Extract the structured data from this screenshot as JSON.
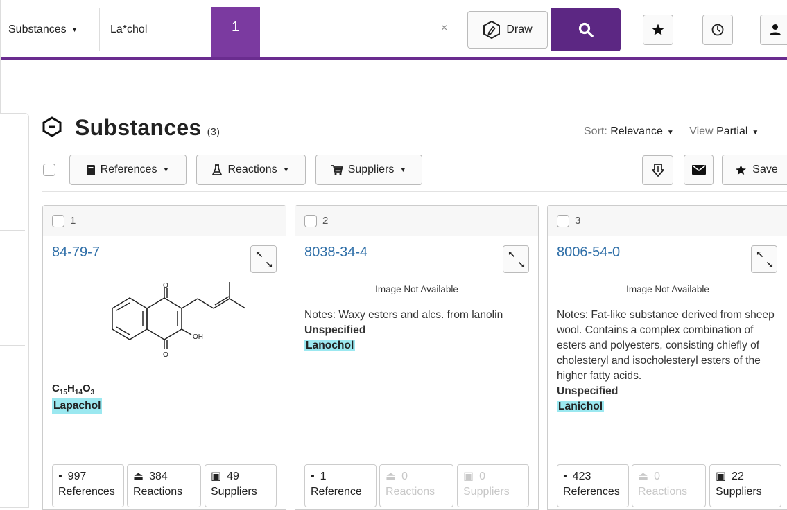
{
  "search": {
    "type_label": "Substances",
    "query": "La*chol",
    "step_badge": "1",
    "clear_symbol": "×",
    "draw_label": "Draw"
  },
  "heading": {
    "title": "Substances",
    "count": "(3)",
    "sort_label": "Sort:",
    "sort_value": "Relevance",
    "view_label": "View",
    "view_value": "Partial"
  },
  "toolbar": {
    "references_label": "References",
    "reactions_label": "Reactions",
    "suppliers_label": "Suppliers",
    "save_label": "Save"
  },
  "results": [
    {
      "index": "1",
      "cas": "84-79-7",
      "formula": {
        "C": "C",
        "c_n": "15",
        "H": "H",
        "h_n": "14",
        "O": "O",
        "o_n": "3"
      },
      "name": "Lapachol",
      "stats": {
        "references_count": "997",
        "references_label": "References",
        "reactions_count": "384",
        "reactions_label": "Reactions",
        "suppliers_count": "49",
        "suppliers_label": "Suppliers"
      }
    },
    {
      "index": "2",
      "cas": "8038-34-4",
      "image_note": "Image Not Available",
      "notes": "Notes: Waxy esters and alcs. from lanolin",
      "spec": "Unspecified",
      "name": "Lanochol",
      "stats": {
        "references_count": "1",
        "references_label": "Reference",
        "reactions_count": "0",
        "reactions_label": "Reactions",
        "suppliers_count": "0",
        "suppliers_label": "Suppliers"
      }
    },
    {
      "index": "3",
      "cas": "8006-54-0",
      "image_note": "Image Not Available",
      "notes": "Notes: Fat-like substance derived from sheep wool. Contains a complex combination of esters and polyesters, consisting chiefly of cholesteryl and isocholesteryl esters of the higher fatty acids.",
      "spec": "Unspecified",
      "name": "Lanichol",
      "stats": {
        "references_count": "423",
        "references_label": "References",
        "reactions_count": "0",
        "reactions_label": "Reactions",
        "suppliers_count": "22",
        "suppliers_label": "Suppliers"
      }
    }
  ],
  "structure_atoms": {
    "o_top": "O",
    "o_bottom": "O",
    "oh": "OH"
  },
  "colors": {
    "accent": "#5c2783",
    "badge": "#7b3aa0",
    "link": "#2f6fa8",
    "highlight": "#9be8f0"
  }
}
